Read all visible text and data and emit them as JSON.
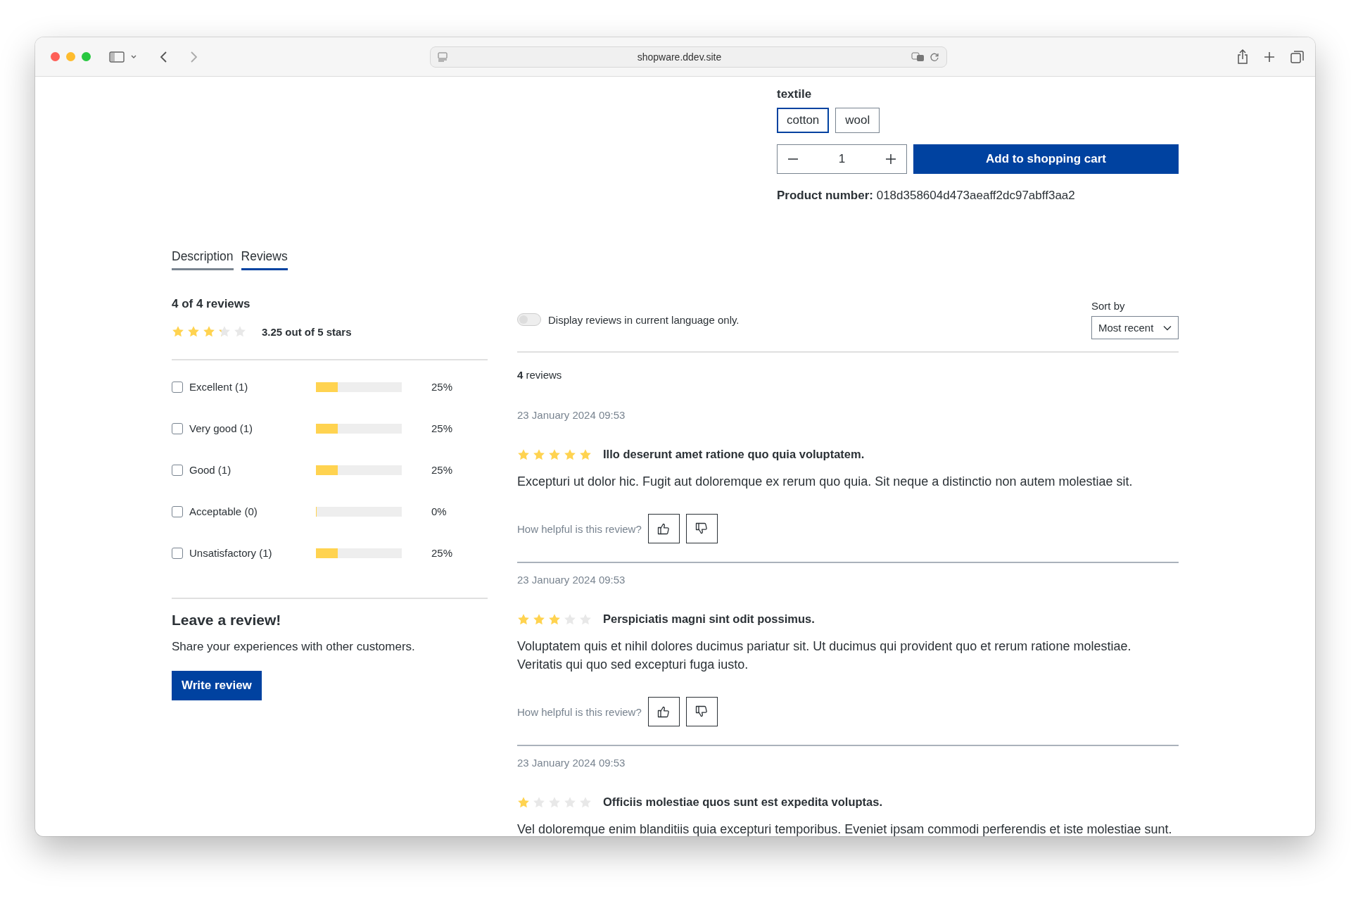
{
  "browser": {
    "url": "shopware.ddev.site"
  },
  "product": {
    "option_group": "textile",
    "options": [
      {
        "label": "cotton",
        "selected": true
      },
      {
        "label": "wool",
        "selected": false
      }
    ],
    "quantity": "1",
    "add_to_cart": "Add to shopping cart",
    "number_label": "Product number:",
    "number": "018d358604d473aeaff2dc97abff3aa2"
  },
  "tabs": [
    {
      "label": "Description",
      "selected": false
    },
    {
      "label": "Reviews",
      "selected": true
    }
  ],
  "summary": {
    "title": "4 of 4 reviews",
    "stars": 3.25,
    "rating_text": "3.25 out of 5 stars",
    "filters": [
      {
        "label": "Excellent (1)",
        "checked": false,
        "level": 0.25,
        "percent": "25%"
      },
      {
        "label": "Very good (1)",
        "checked": false,
        "level": 0.25,
        "percent": "25%"
      },
      {
        "label": "Good (1)",
        "checked": false,
        "level": 0.25,
        "percent": "25%"
      },
      {
        "label": "Acceptable (0)",
        "checked": false,
        "level": 0,
        "percent": "0%"
      },
      {
        "label": "Unsatisfactory (1)",
        "checked": false,
        "level": 0.25,
        "percent": "25%"
      }
    ]
  },
  "leave_review": {
    "title": "Leave a review!",
    "text": "Share your experiences with other customers.",
    "button": "Write review"
  },
  "reviews_panel": {
    "language_toggle": {
      "label": "Display reviews in current language only.",
      "on": false
    },
    "sort": {
      "label": "Sort by",
      "value": "Most recent"
    },
    "count": "**4** reviews",
    "reviews": [
      {
        "date": "23 January 2024 09:53",
        "stars": 5,
        "title": "Illo deserunt amet ratione quo quia voluptatem.",
        "text": "Excepturi ut dolor hic. Fugit aut doloremque ex rerum quo quia. Sit neque a distinctio non autem molestiae sit.",
        "helpful_label": "How helpful is this review?"
      },
      {
        "date": "23 January 2024 09:53",
        "stars": 3,
        "title": "Perspiciatis magni sint odit possimus.",
        "text": "Voluptatem quis et nihil dolores ducimus pariatur sit. Ut ducimus qui provident quo et rerum ratione molestiae. Veritatis qui quo sed excepturi fuga iusto.",
        "helpful_label": "How helpful is this review?"
      },
      {
        "date": "23 January 2024 09:53",
        "stars": 1,
        "title": "Officiis molestiae quos sunt est expedita voluptas.",
        "text": "Vel doloremque enim blanditiis quia excepturi temporibus. Eveniet ipsam commodi perferendis et iste molestiae sunt."
      }
    ]
  }
}
